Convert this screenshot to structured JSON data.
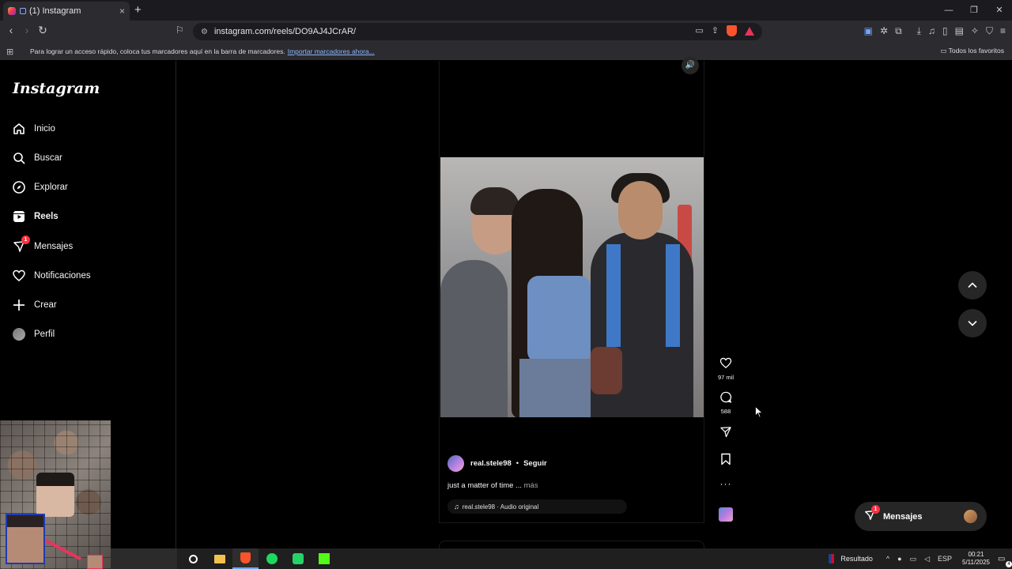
{
  "browser": {
    "tab_title": "(1) Instagram",
    "tab_close": "×",
    "new_tab": "+",
    "url": "instagram.com/reels/DO9AJ4JCrAR/",
    "bookmarks_hint": "Para lograr un acceso rápido, coloca tus marcadores aquí en la barra de marcadores.",
    "bookmarks_import": "Importar marcadores ahora...",
    "all_favorites": "Todos los favoritos"
  },
  "instagram": {
    "logo": "Instagram",
    "nav": [
      {
        "label": "Inicio",
        "icon": "home-icon"
      },
      {
        "label": "Buscar",
        "icon": "search-icon"
      },
      {
        "label": "Explorar",
        "icon": "compass-icon"
      },
      {
        "label": "Reels",
        "icon": "reels-icon",
        "active": true
      },
      {
        "label": "Mensajes",
        "icon": "messenger-icon",
        "badge": "1"
      },
      {
        "label": "Notificaciones",
        "icon": "heart-icon"
      },
      {
        "label": "Crear",
        "icon": "plus-icon"
      },
      {
        "label": "Perfil",
        "icon": "avatar"
      }
    ],
    "reel": {
      "likes": "97 mil",
      "comments": "588",
      "author": "real.stele98",
      "separator": "•",
      "follow": "Seguir",
      "caption": "just a matter of time ...",
      "caption_more": "más",
      "audio": "real.stele98 · Audio original"
    },
    "messages_pill": {
      "label": "Mensajes",
      "badge": "1"
    }
  },
  "taskbar": {
    "result_label": "Resultado",
    "language": "ESP",
    "time": "00:21",
    "date": "5/11/2025",
    "notifications": "4"
  },
  "colors": {
    "background": "#000000",
    "badge": "#ff3040",
    "chrome": "#2b2b30"
  }
}
